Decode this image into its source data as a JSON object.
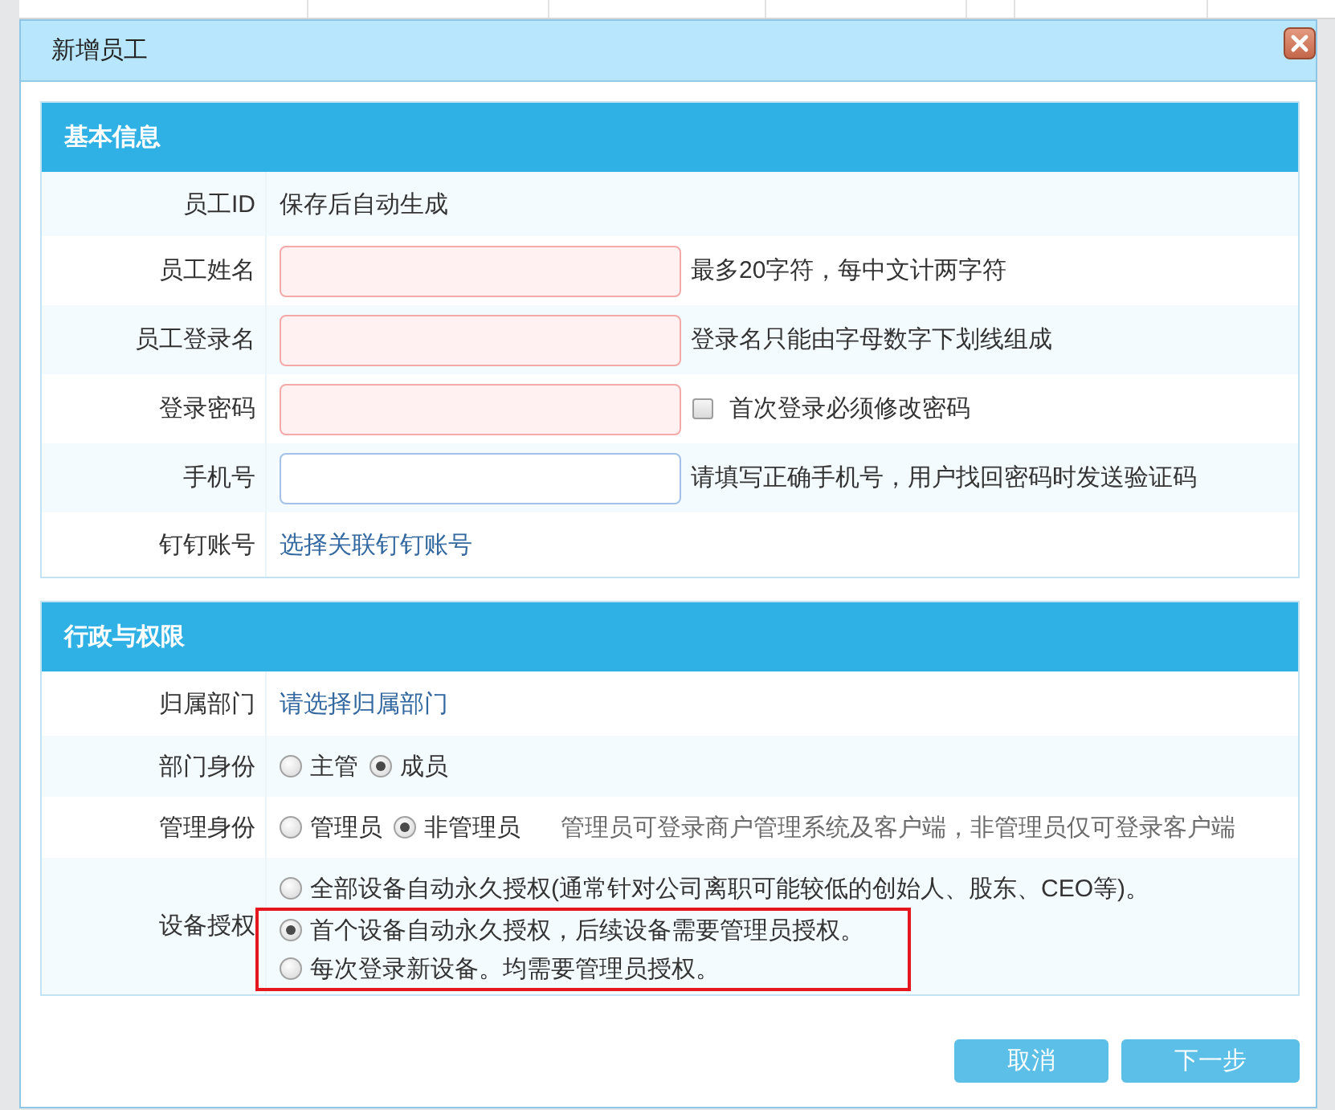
{
  "dialog": {
    "title": "新增员工"
  },
  "sections": [
    {
      "title": "基本信息",
      "rows": [
        {
          "kind": "text",
          "label": "员工ID",
          "value": "保存后自动生成"
        },
        {
          "kind": "input",
          "label": "员工姓名",
          "invalid": true,
          "hint": "最多20字符，每中文计两字符"
        },
        {
          "kind": "input",
          "label": "员工登录名",
          "invalid": true,
          "hint": "登录名只能由字母数字下划线组成"
        },
        {
          "kind": "input",
          "label": "登录密码",
          "invalid": true,
          "checkbox": {
            "label": "首次登录必须修改密码",
            "checked": false
          }
        },
        {
          "kind": "input",
          "label": "手机号",
          "invalid": false,
          "hint": "请填写正确手机号，用户找回密码时发送验证码"
        },
        {
          "kind": "link",
          "label": "钉钉账号",
          "link": "选择关联钉钉账号"
        }
      ]
    },
    {
      "title": "行政与权限",
      "rows": [
        {
          "kind": "link",
          "label": "归属部门",
          "link": "请选择归属部门"
        },
        {
          "kind": "radio",
          "label": "部门身份",
          "options": [
            {
              "label": "主管",
              "selected": false
            },
            {
              "label": "成员",
              "selected": true
            }
          ]
        },
        {
          "kind": "radio",
          "label": "管理身份",
          "options": [
            {
              "label": "管理员",
              "selected": false
            },
            {
              "label": "非管理员",
              "selected": true
            }
          ],
          "hint": "管理员可登录商户管理系统及客户端，非管理员仅可登录客户端"
        },
        {
          "kind": "radio-list",
          "label": "设备授权",
          "options": [
            {
              "label": "全部设备自动永久授权(通常针对公司离职可能较低的创始人、股东、CEO等)。",
              "selected": false,
              "highlighted": false
            },
            {
              "label": "首个设备自动永久授权，后续设备需要管理员授权。",
              "selected": true,
              "highlighted": true
            },
            {
              "label": "每次登录新设备。均需要管理员授权。",
              "selected": false,
              "highlighted": true
            }
          ]
        }
      ]
    }
  ],
  "buttons": [
    {
      "label": "取消"
    },
    {
      "label": "下一步"
    }
  ]
}
